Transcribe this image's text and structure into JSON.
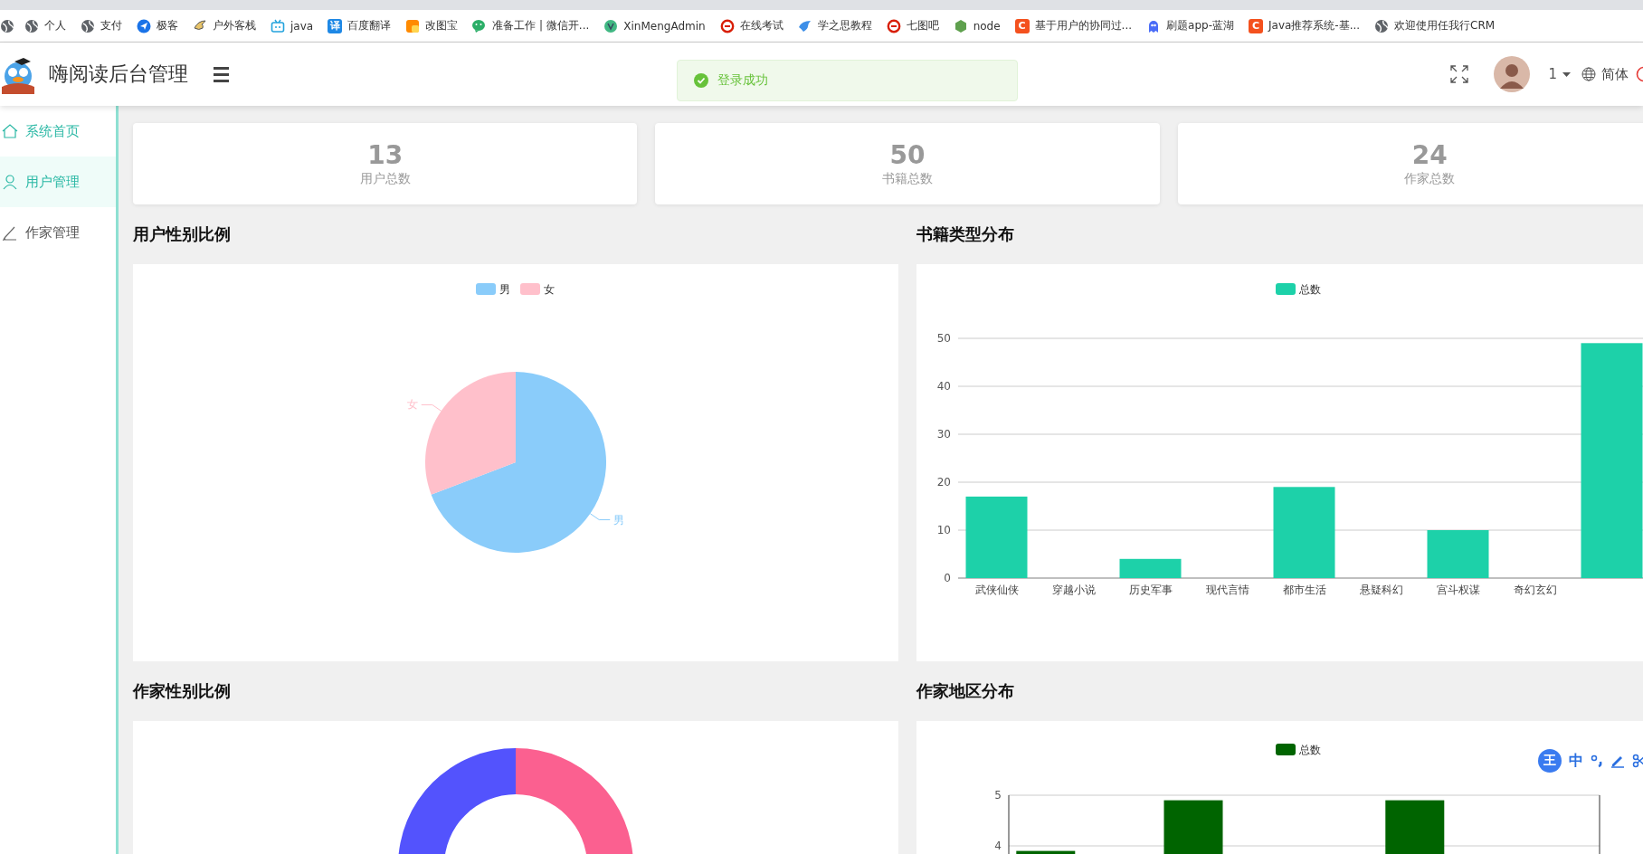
{
  "browser": {
    "bookmarks": [
      {
        "kind": "icon"
      },
      {
        "label": "个人"
      },
      {
        "label": "支付"
      },
      {
        "label": "极客"
      },
      {
        "label": "户外客栈"
      },
      {
        "label": "java"
      },
      {
        "label": "百度翻译",
        "icon_text": "译"
      },
      {
        "label": "改图宝"
      },
      {
        "label": "准备工作 | 微信开..."
      },
      {
        "label": "XinMengAdmin"
      },
      {
        "label": "在线考试"
      },
      {
        "label": "学之思教程"
      },
      {
        "label": "七图吧"
      },
      {
        "label": "node"
      },
      {
        "label": "基于用户的协同过...",
        "icon_text": "C"
      },
      {
        "label": "刷题app-蓝湖"
      },
      {
        "label": "Java推荐系统-基...",
        "icon_text": "C"
      },
      {
        "label": "欢迎使用任我行CRM"
      }
    ]
  },
  "header": {
    "title": "嗨阅读后台管理",
    "toast": "登录成功",
    "user": "1",
    "language": "简体"
  },
  "sidebar": {
    "items": [
      {
        "label": "系统首页",
        "selected": true,
        "hovered": false
      },
      {
        "label": "用户管理",
        "selected": false,
        "hovered": true
      },
      {
        "label": "作家管理",
        "selected": false,
        "hovered": false
      }
    ]
  },
  "stats": [
    {
      "value": "13",
      "label": "用户总数"
    },
    {
      "value": "50",
      "label": "书籍总数"
    },
    {
      "value": "24",
      "label": "作家总数"
    }
  ],
  "panels": [
    {
      "title": "用户性别比例",
      "legend": [
        {
          "label": "男",
          "color": "#8accfa"
        },
        {
          "label": "女",
          "color": "#ffc0cb"
        }
      ],
      "chart_data": {
        "type": "pie",
        "categories": [
          "男",
          "女"
        ],
        "values": [
          69.2,
          30.8
        ]
      }
    },
    {
      "title": "书籍类型分布",
      "chart_data": {
        "type": "bar",
        "categories": [
          "武侠仙侠",
          "穿越小说",
          "历史军事",
          "现代言情",
          "都市生活",
          "悬疑科幻",
          "宫斗权谋",
          "奇幻玄幻",
          null
        ],
        "series": [
          {
            "name": "总数",
            "color": "#1dd1a9",
            "values": [
              17,
              0,
              4,
              0,
              19,
              0,
              10,
              0,
              49
            ]
          }
        ],
        "yticks": [
          0,
          10,
          20,
          30,
          40,
          50
        ],
        "ylim": [
          0,
          50
        ],
        "grid": true
      }
    },
    {
      "title": "作家性别比例",
      "kind": "donut"
    },
    {
      "title": "作家地区分布",
      "chart_data": {
        "type": "bar",
        "series": [
          {
            "name": "总数",
            "color": "#006400",
            "values": [
              3.9,
              null,
              4.9,
              null,
              null,
              4.9,
              null,
              null
            ]
          }
        ],
        "yticks": [
          4,
          5
        ],
        "ylim": [
          3,
          5
        ],
        "grid": true
      }
    }
  ],
  "ime": {
    "badge": "王",
    "mode": "中"
  }
}
